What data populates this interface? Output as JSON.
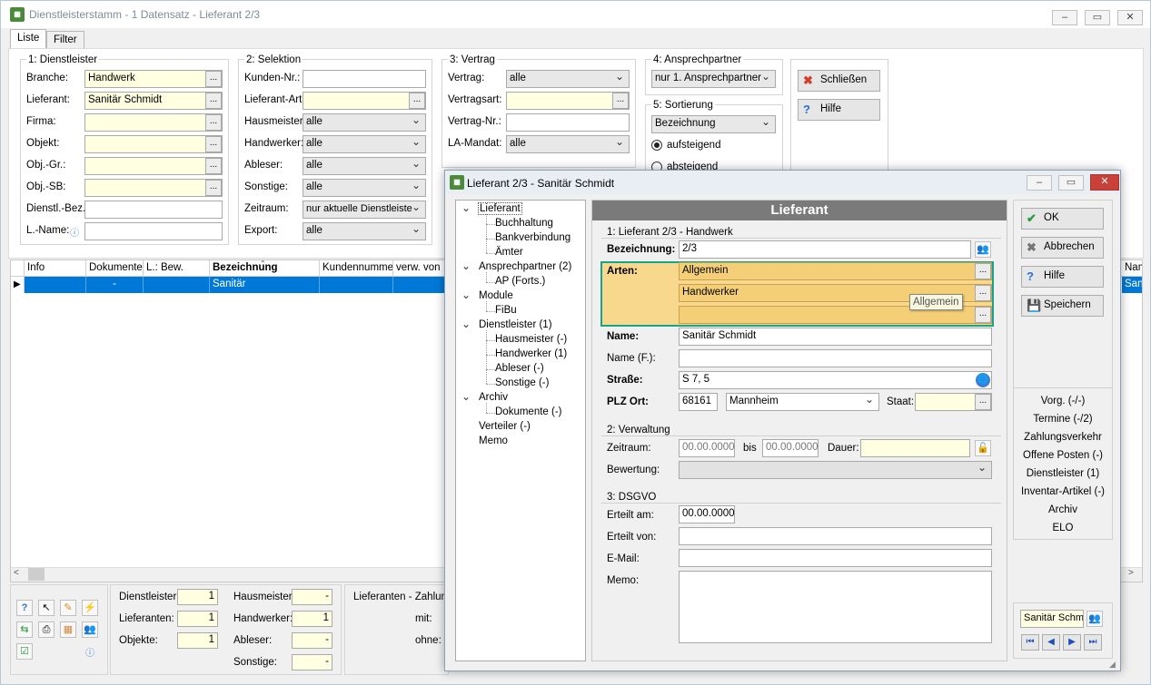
{
  "main_window": {
    "title": "Dienstleisterstamm - 1 Datensatz - Lieferant 2/3",
    "tabs": [
      "Liste",
      "Filter"
    ],
    "group1": {
      "title": "1: Dienstleister",
      "fields": [
        {
          "label": "Branche:",
          "value": "Handwerk"
        },
        {
          "label": "Lieferant:",
          "value": "Sanitär Schmidt"
        },
        {
          "label": "Firma:",
          "value": ""
        },
        {
          "label": "Objekt:",
          "value": ""
        },
        {
          "label": "Obj.-Gr.:",
          "value": ""
        },
        {
          "label": "Obj.-SB:",
          "value": ""
        },
        {
          "label": "Dienstl.-Bez.:",
          "value": ""
        },
        {
          "label": "L.-Name:",
          "value": ""
        }
      ]
    },
    "group2": {
      "title": "2: Selektion",
      "fields": [
        {
          "label": "Kunden-Nr.:",
          "value": ""
        },
        {
          "label": "Lieferant-Art:",
          "value": ""
        },
        {
          "label": "Hausmeister:",
          "value": "alle"
        },
        {
          "label": "Handwerker:",
          "value": "alle"
        },
        {
          "label": "Ableser:",
          "value": "alle"
        },
        {
          "label": "Sonstige:",
          "value": "alle"
        },
        {
          "label": "Zeitraum:",
          "value": "nur aktuelle Dienstleiste"
        },
        {
          "label": "Export:",
          "value": "alle"
        }
      ]
    },
    "group3": {
      "title": "3: Vertrag",
      "fields": [
        {
          "label": "Vertrag:",
          "value": "alle"
        },
        {
          "label": "Vertragsart:",
          "value": ""
        },
        {
          "label": "Vertrag-Nr.:",
          "value": ""
        },
        {
          "label": "LA-Mandat:",
          "value": "alle"
        }
      ]
    },
    "group4": {
      "title": "4: Ansprechpartner",
      "value": "nur 1. Ansprechpartner"
    },
    "group5": {
      "title": "5: Sortierung",
      "value": "Bezeichnung",
      "radio1": "aufsteigend",
      "radio2": "absteigend"
    },
    "buttons": {
      "close": "Schließen",
      "help": "Hilfe"
    },
    "grid": {
      "columns": [
        "Info",
        "Dokumente",
        "L.: Bew.",
        "Bezeichnung",
        "Kundennummer",
        "verw. von",
        "Nam"
      ],
      "row": [
        "",
        "-",
        "",
        "Sanitär",
        "",
        "",
        "Sanitär S"
      ]
    },
    "summary": {
      "dienstleister_label": "Dienstleister:",
      "dienstleister": "1",
      "lieferanten_label": "Lieferanten:",
      "lieferanten": "1",
      "objekte_label": "Objekte:",
      "objekte": "1",
      "hausmeister_label": "Hausmeister:",
      "hausmeister": "-",
      "handwerker_label": "Handwerker:",
      "handwerker": "1",
      "ableser_label": "Ableser:",
      "ableser": "-",
      "sonstige_label": "Sonstige:",
      "sonstige": "-",
      "zahlung_title": "Lieferanten - Zahlung",
      "mit_label": "mit:",
      "ohne_label": "ohne:"
    }
  },
  "dialog": {
    "title": "Lieferant 2/3 - Sanitär Schmidt",
    "tree": [
      {
        "label": "Lieferant",
        "level": 0,
        "expander": true
      },
      {
        "label": "Buchhaltung",
        "level": 1
      },
      {
        "label": "Bankverbindung",
        "level": 1
      },
      {
        "label": "Ämter",
        "level": 1
      },
      {
        "label": "Ansprechpartner (2)",
        "level": 0,
        "expander": true
      },
      {
        "label": "AP (Forts.)",
        "level": 1
      },
      {
        "label": "Module",
        "level": 0,
        "expander": true
      },
      {
        "label": "FiBu",
        "level": 1
      },
      {
        "label": "Dienstleister (1)",
        "level": 0,
        "expander": true
      },
      {
        "label": "Hausmeister (-)",
        "level": 1
      },
      {
        "label": "Handwerker (1)",
        "level": 1
      },
      {
        "label": "Ableser (-)",
        "level": 1
      },
      {
        "label": "Sonstige (-)",
        "level": 1
      },
      {
        "label": "Archiv",
        "level": 0,
        "expander": true
      },
      {
        "label": "Dokumente (-)",
        "level": 1
      },
      {
        "label": "Verteiler (-)",
        "level": 0
      },
      {
        "label": "Memo",
        "level": 0
      }
    ],
    "header": "Lieferant",
    "section1": "1: Lieferant 2/3 - Handwerk",
    "bezeichnung_label": "Bezeichnung:",
    "bezeichnung": "2/3",
    "arten_label": "Arten:",
    "arten": [
      "Allgemein",
      "Handwerker",
      ""
    ],
    "tooltip": "Allgemein",
    "name_label": "Name:",
    "name": "Sanitär Schmidt",
    "name_f_label": "Name (F.):",
    "name_f": "",
    "strasse_label": "Straße:",
    "strasse": "S 7, 5",
    "plz_label": "PLZ Ort:",
    "plz": "68161",
    "ort": "Mannheim",
    "staat_label": "Staat:",
    "staat": "",
    "section2": "2: Verwaltung",
    "zeitraum_label": "Zeitraum:",
    "von": "00.00.0000",
    "bis_label": "bis",
    "bis": "00.00.0000",
    "dauer_label": "Dauer:",
    "dauer": "",
    "bewertung_label": "Bewertung:",
    "bewertung": "",
    "section3": "3: DSGVO",
    "erteilt_am_label": "Erteilt am:",
    "erteilt_am": "00.00.0000",
    "erteilt_von_label": "Erteilt von:",
    "erteilt_von": "",
    "email_label": "E-Mail:",
    "email": "",
    "memo_label": "Memo:",
    "memo": "",
    "buttons": {
      "ok": "OK",
      "cancel": "Abbrechen",
      "help": "Hilfe",
      "save": "Speichern"
    },
    "side_items": [
      "Vorg. (-/-)",
      "Termine (-/2)",
      "Zahlungsverkehr",
      "Offene Posten (-)",
      "Dienstleister (1)",
      "Inventar-Artikel (-)",
      "Archiv",
      "ELO"
    ],
    "nav_value": "Sanitär Schm"
  }
}
